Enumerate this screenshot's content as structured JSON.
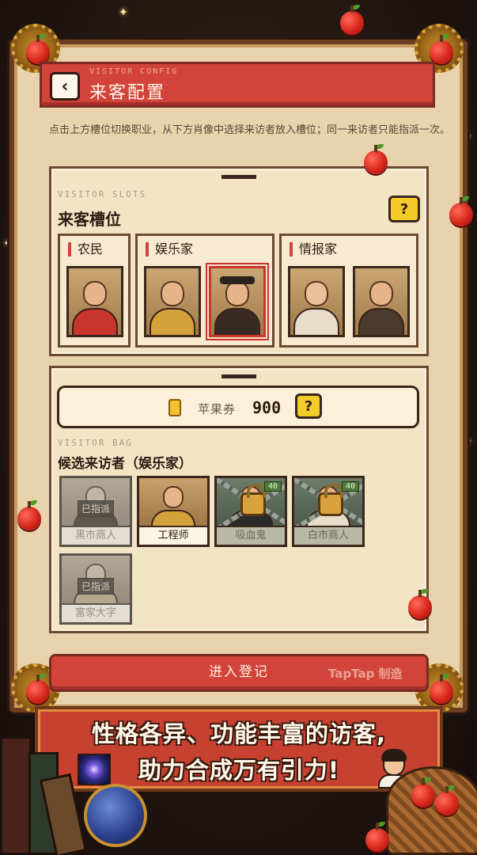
{
  "header": {
    "subtitle": "VISITOR CONFIG",
    "title": "来客配置",
    "back_icon": "chevron-left"
  },
  "instructions": "点击上方槽位切换职业，从下方肖像中选择来访者放入槽位；同一来访者只能指派一次。",
  "slots_section": {
    "subtitle": "VISITOR SLOTS",
    "title": "来客槽位",
    "help_label": "?",
    "groups": [
      {
        "label": "农民",
        "portraits": [
          "farmer-woman"
        ]
      },
      {
        "label": "娱乐家",
        "portraits": [
          "entertainer-man",
          "hat-man"
        ]
      },
      {
        "label": "情报家",
        "portraits": [
          "old-woman",
          "old-man"
        ]
      }
    ]
  },
  "currency": {
    "label": "苹果券",
    "value": "900",
    "help_label": "?"
  },
  "bag_section": {
    "subtitle": "VISITOR BAG",
    "title": "候选来访者（娱乐家）",
    "visitors": [
      {
        "name": "黑市商人",
        "state": "assigned",
        "tag": "已指派"
      },
      {
        "name": "工程师",
        "state": "available"
      },
      {
        "name": "吸血鬼",
        "state": "locked",
        "badge": "40"
      },
      {
        "name": "白市商人",
        "state": "locked",
        "badge": "40"
      },
      {
        "name": "富家大字",
        "state": "assigned",
        "tag": "已指派"
      }
    ]
  },
  "enter_button": "进入登记",
  "watermark": "TapTap 制造",
  "promo": {
    "line1": "性格各异、功能丰富的访客,",
    "line2": "助力合成万有引力!"
  },
  "colors": {
    "accent_red": "#d2443a",
    "parchment": "#f3e4c6",
    "frame_brown": "#6b3d21",
    "help_yellow": "#f4cc2a"
  }
}
